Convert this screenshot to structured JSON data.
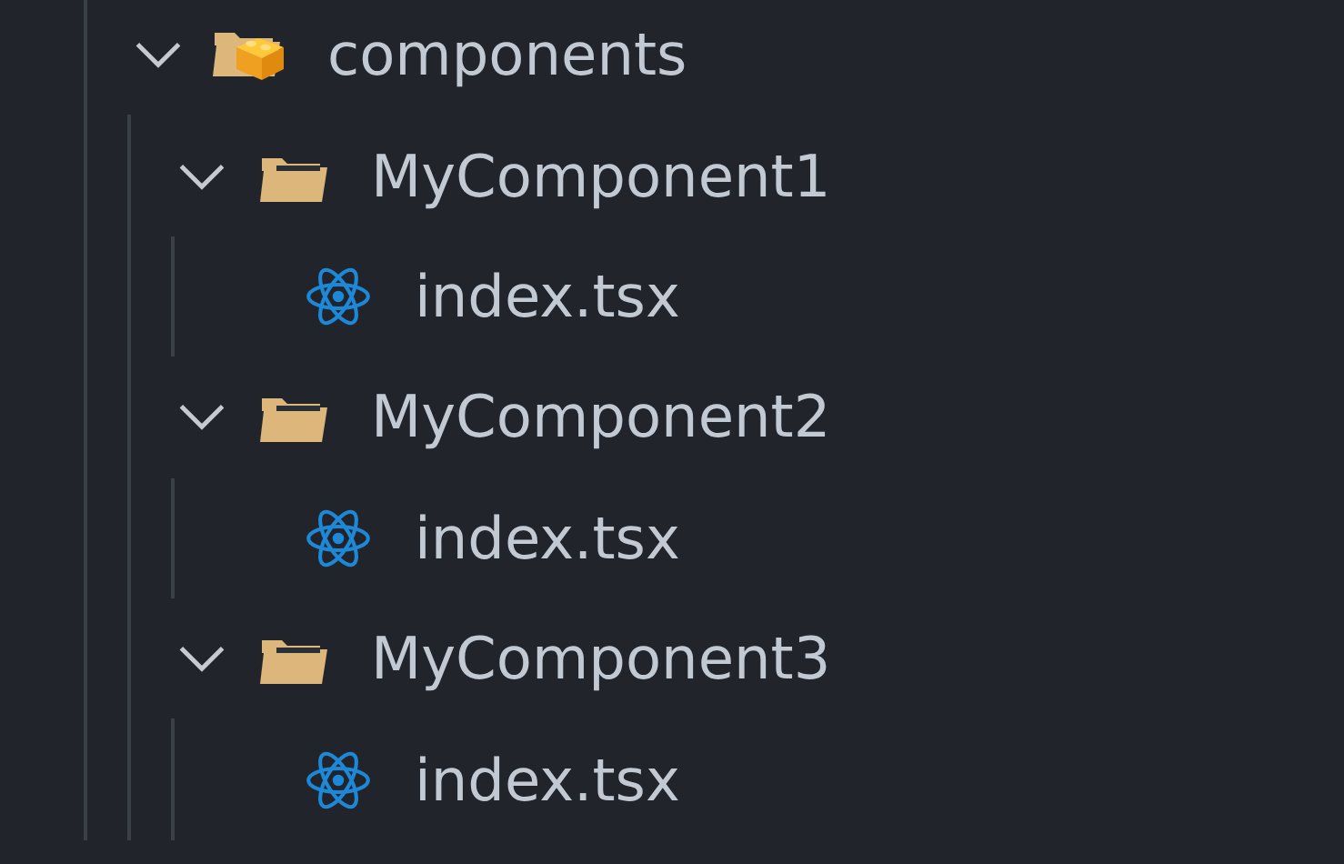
{
  "tree": [
    {
      "name": "components",
      "kind": "component-folder",
      "expanded": true,
      "children": [
        {
          "name": "MyComponent1",
          "kind": "folder",
          "expanded": true,
          "children": [
            {
              "name": "index.tsx",
              "kind": "react-file"
            }
          ]
        },
        {
          "name": "MyComponent2",
          "kind": "folder",
          "expanded": true,
          "children": [
            {
              "name": "index.tsx",
              "kind": "react-file"
            }
          ]
        },
        {
          "name": "MyComponent3",
          "kind": "folder",
          "expanded": true,
          "children": [
            {
              "name": "index.tsx",
              "kind": "react-file"
            }
          ]
        }
      ]
    }
  ]
}
